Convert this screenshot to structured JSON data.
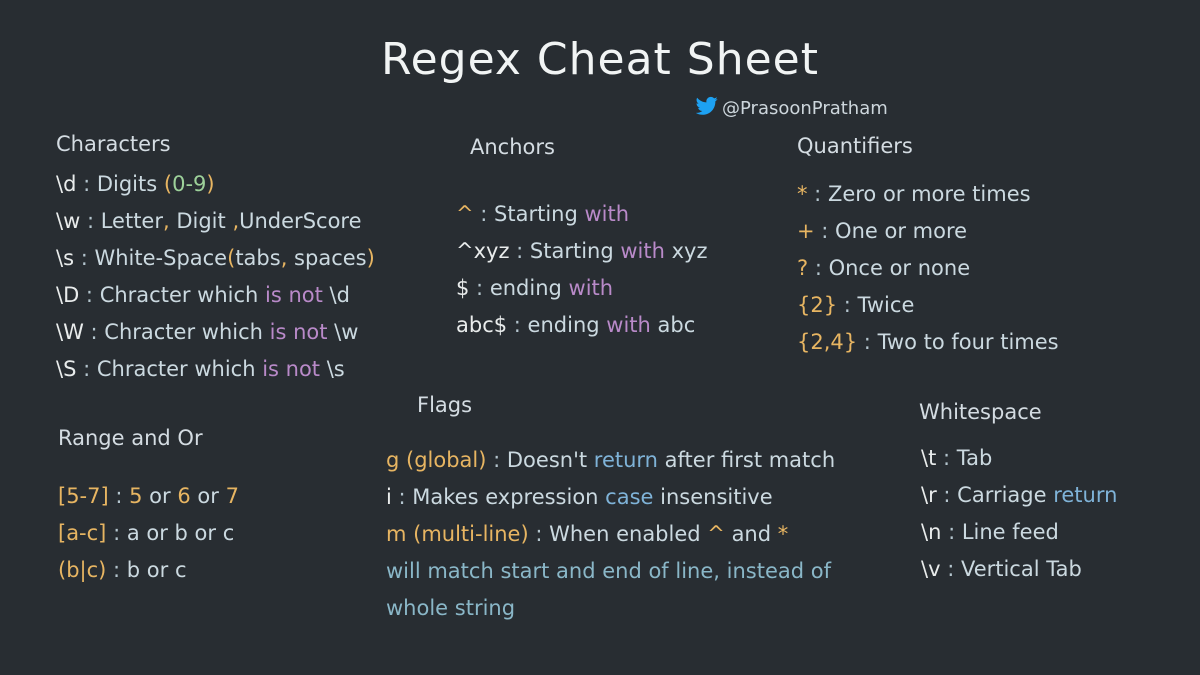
{
  "title": "Regex Cheat Sheet",
  "handle": "@PrasoonPratham",
  "sections": {
    "characters": {
      "heading": "Characters",
      "rows": [
        [
          {
            "t": "\\d",
            "c": ""
          },
          {
            "t": " : ",
            "c": "sep"
          },
          {
            "t": "Digits ",
            "c": "t"
          },
          {
            "t": "(",
            "c": "hl-or"
          },
          {
            "t": "0-9",
            "c": "hl-gr"
          },
          {
            "t": ")",
            "c": "hl-or"
          }
        ],
        [
          {
            "t": "\\w",
            "c": ""
          },
          {
            "t": " : ",
            "c": "sep"
          },
          {
            "t": "Letter",
            "c": "t"
          },
          {
            "t": ",",
            "c": "hl-or"
          },
          {
            "t": " Digit ",
            "c": "t"
          },
          {
            "t": ",",
            "c": "hl-or"
          },
          {
            "t": "UnderScore",
            "c": "t"
          }
        ],
        [
          {
            "t": "\\s",
            "c": ""
          },
          {
            "t": " : ",
            "c": "sep"
          },
          {
            "t": "White-Space",
            "c": "t"
          },
          {
            "t": "(",
            "c": "hl-or"
          },
          {
            "t": "tabs",
            "c": "t"
          },
          {
            "t": ",",
            "c": "hl-or"
          },
          {
            "t": " spaces",
            "c": "t"
          },
          {
            "t": ")",
            "c": "hl-or"
          }
        ],
        [
          {
            "t": "\\D",
            "c": ""
          },
          {
            "t": " : ",
            "c": "sep"
          },
          {
            "t": "Chracter which ",
            "c": "t"
          },
          {
            "t": "is not",
            "c": "hl-pu"
          },
          {
            "t": " \\d",
            "c": "t"
          }
        ],
        [
          {
            "t": "\\W",
            "c": ""
          },
          {
            "t": " : ",
            "c": "sep"
          },
          {
            "t": "Chracter which ",
            "c": "t"
          },
          {
            "t": "is not",
            "c": "hl-pu"
          },
          {
            "t": " \\w",
            "c": "t"
          }
        ],
        [
          {
            "t": "\\S",
            "c": ""
          },
          {
            "t": " : ",
            "c": "sep"
          },
          {
            "t": "Chracter which ",
            "c": "t"
          },
          {
            "t": "is not",
            "c": "hl-pu"
          },
          {
            "t": " \\s",
            "c": "t"
          }
        ]
      ]
    },
    "anchors": {
      "heading": "Anchors",
      "rows": [
        [
          {
            "t": "^",
            "c": "hl-or"
          },
          {
            "t": " : ",
            "c": "sep"
          },
          {
            "t": "Starting ",
            "c": "t"
          },
          {
            "t": "with",
            "c": "hl-pu"
          }
        ],
        [
          {
            "t": "^xyz",
            "c": ""
          },
          {
            "t": " : ",
            "c": "sep"
          },
          {
            "t": "Starting ",
            "c": "t"
          },
          {
            "t": "with",
            "c": "hl-pu"
          },
          {
            "t": " xyz",
            "c": "t"
          }
        ],
        [
          {
            "t": "$",
            "c": ""
          },
          {
            "t": " : ",
            "c": "sep"
          },
          {
            "t": "ending ",
            "c": "t"
          },
          {
            "t": "with",
            "c": "hl-pu"
          }
        ],
        [
          {
            "t": "abc$",
            "c": ""
          },
          {
            "t": " : ",
            "c": "sep"
          },
          {
            "t": "ending ",
            "c": "t"
          },
          {
            "t": "with",
            "c": "hl-pu"
          },
          {
            "t": " abc",
            "c": "t"
          }
        ]
      ]
    },
    "quantifiers": {
      "heading": "Quantifiers",
      "rows": [
        [
          {
            "t": "*",
            "c": "hl-or"
          },
          {
            "t": " : ",
            "c": "sep"
          },
          {
            "t": "Zero or more times",
            "c": "t"
          }
        ],
        [
          {
            "t": "+",
            "c": "hl-or"
          },
          {
            "t": " : ",
            "c": "sep"
          },
          {
            "t": "One or more",
            "c": "t"
          }
        ],
        [
          {
            "t": "?",
            "c": "hl-or"
          },
          {
            "t": " :  ",
            "c": "sep"
          },
          {
            "t": "Once or none",
            "c": "t"
          }
        ],
        [
          {
            "t": "{2}",
            "c": "hl-or"
          },
          {
            "t": " : ",
            "c": "sep"
          },
          {
            "t": "Twice",
            "c": "t"
          }
        ],
        [
          {
            "t": "{2,4}",
            "c": "hl-or"
          },
          {
            "t": " : ",
            "c": "sep"
          },
          {
            "t": "Two to four times",
            "c": "t"
          }
        ]
      ]
    },
    "range": {
      "heading": "Range and Or",
      "rows": [
        [
          {
            "t": "[5-7]",
            "c": "hl-or"
          },
          {
            "t": " : ",
            "c": "sep"
          },
          {
            "t": "5 ",
            "c": "hl-or"
          },
          {
            "t": "or ",
            "c": "t"
          },
          {
            "t": "6",
            "c": "hl-or"
          },
          {
            "t": " or ",
            "c": "t"
          },
          {
            "t": "7",
            "c": "hl-or"
          }
        ],
        [
          {
            "t": "[a-c]",
            "c": "hl-or"
          },
          {
            "t": " : ",
            "c": "sep"
          },
          {
            "t": "a or b or c",
            "c": "t"
          }
        ],
        [
          {
            "t": "(b|c)",
            "c": "hl-or"
          },
          {
            "t": " :  ",
            "c": "sep"
          },
          {
            "t": "b or c",
            "c": "t"
          }
        ]
      ]
    },
    "flags": {
      "heading": "Flags",
      "rows": [
        [
          {
            "t": "g ",
            "c": "hl-or"
          },
          {
            "t": "(global)",
            "c": "hl-or"
          },
          {
            "t": " : ",
            "c": "sep"
          },
          {
            "t": "Doesn't ",
            "c": "t"
          },
          {
            "t": "return",
            "c": "hl-bl"
          },
          {
            "t": " after first match",
            "c": "t"
          }
        ],
        [
          {
            "t": "i",
            "c": ""
          },
          {
            "t": " : ",
            "c": "sep"
          },
          {
            "t": "Makes expression ",
            "c": "t"
          },
          {
            "t": "case",
            "c": "hl-bl"
          },
          {
            "t": " insensitive",
            "c": "t"
          }
        ],
        [
          {
            "t": "m ",
            "c": "hl-or"
          },
          {
            "t": "(multi-line)",
            "c": "hl-or"
          },
          {
            "t": " : ",
            "c": "sep"
          },
          {
            "t": "When enabled ",
            "c": "t"
          },
          {
            "t": "^",
            "c": "hl-or"
          },
          {
            "t": " and ",
            "c": "t"
          },
          {
            "t": "*",
            "c": "hl-or"
          }
        ],
        [
          {
            "t": "will match start and end ",
            "c": "hl-tl"
          },
          {
            "t": "of",
            "c": "hl-tl"
          },
          {
            "t": " line, instead of",
            "c": "hl-tl"
          }
        ],
        [
          {
            "t": "whole string",
            "c": "hl-tl"
          }
        ]
      ]
    },
    "whitespace": {
      "heading": "Whitespace",
      "rows": [
        [
          {
            "t": "\\t",
            "c": ""
          },
          {
            "t": " : ",
            "c": "sep"
          },
          {
            "t": "Tab",
            "c": "t"
          }
        ],
        [
          {
            "t": "\\r",
            "c": ""
          },
          {
            "t": " : ",
            "c": "sep"
          },
          {
            "t": "Carriage ",
            "c": "t"
          },
          {
            "t": "return",
            "c": "hl-bl"
          }
        ],
        [
          {
            "t": "\\n",
            "c": ""
          },
          {
            "t": " :  ",
            "c": "sep"
          },
          {
            "t": "Line feed",
            "c": "t"
          }
        ],
        [
          {
            "t": "\\v",
            "c": ""
          },
          {
            "t": " : ",
            "c": "sep"
          },
          {
            "t": "Vertical Tab",
            "c": "t"
          }
        ]
      ]
    }
  },
  "colors": {
    "background": "#282d32",
    "orange": "#e7b562",
    "green": "#9dd19a",
    "purple": "#b98ac9",
    "blue": "#7fb3d8",
    "twitter": "#1da1f2"
  },
  "icons": {
    "handle_icon": "twitter-bird-icon"
  }
}
